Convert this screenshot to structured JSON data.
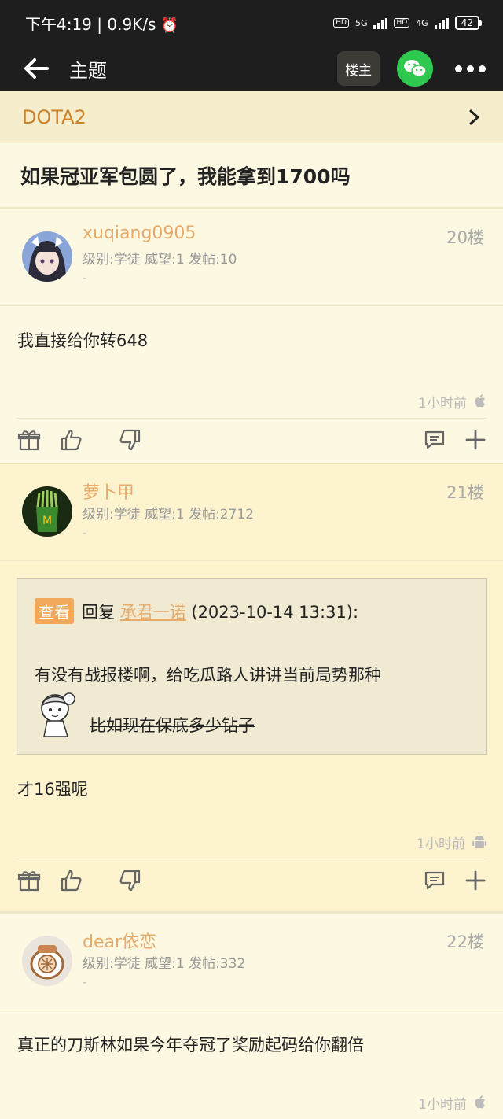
{
  "status": {
    "time": "下午4:19",
    "speed": "0.9K/s",
    "net1": "5G",
    "net2": "4G",
    "hd": "HD",
    "battery": "42"
  },
  "appbar": {
    "title": "主题",
    "owner_label": "楼主"
  },
  "board": {
    "name": "DOTA2"
  },
  "thread": {
    "title": "如果冠亚军包圆了，我能拿到1700吗"
  },
  "posts": [
    {
      "username": "xuqiang0905",
      "meta": "级别:学徒 威望:1 发帖:10",
      "dash": "-",
      "floor": "20楼",
      "content": "我直接给你转648",
      "time": "1小时前",
      "device": "apple-icon"
    },
    {
      "username": "萝卜甲",
      "meta": "级别:学徒 威望:1 发帖:2712",
      "dash": "-",
      "floor": "21楼",
      "quote": {
        "view_label": "查看",
        "reply_label": "回复",
        "reply_name": "承君一诺",
        "reply_time": "(2023-10-14 13:31):",
        "line1": "有没有战报楼啊，给吃瓜路人讲讲当前局势那种",
        "line2": "比如现在保底多少钻子"
      },
      "content": "才16强呢",
      "time": "1小时前",
      "device": "android-icon"
    },
    {
      "username": "dear依恋",
      "meta": "级别:学徒 威望:1 发帖:332",
      "dash": "-",
      "floor": "22楼",
      "content": "真正的刀斯林如果今年夺冠了奖励起码给你翻倍",
      "time": "1小时前",
      "device": "apple-icon"
    }
  ],
  "colors": {
    "username": "#E6AA6A",
    "board": "#C9822B",
    "wechat": "#2DC84D",
    "header_bg": "#1E1E1E",
    "page_bg": "#FDF8E2"
  }
}
